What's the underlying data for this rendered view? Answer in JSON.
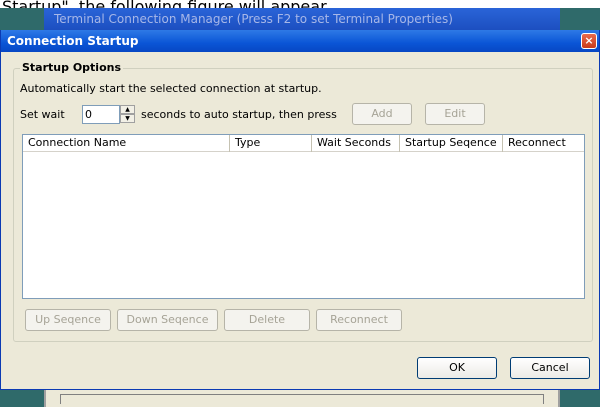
{
  "doc_caption": "Startup\", the following figure will appear.",
  "background_window": {
    "title": "Terminal Connection Manager (Press F2 to set Terminal Properties)"
  },
  "dialog": {
    "title": "Connection Startup",
    "close_label": "×",
    "group_title": "Startup Options",
    "description": "Automatically start the selected connection at startup.",
    "wait_label": "Set wait",
    "wait_value": "0",
    "wait_suffix": "seconds to auto startup, then press",
    "add_label": "Add",
    "edit_label": "Edit",
    "columns": [
      "Connection Name",
      "Type",
      "Wait Seconds",
      "Startup Seqence",
      "Reconnect"
    ],
    "rows": [],
    "up_label": "Up Seqence",
    "down_label": "Down Seqence",
    "delete_label": "Delete",
    "reconnect_label": "Reconnect",
    "ok_label": "OK",
    "cancel_label": "Cancel"
  },
  "colors": {
    "titlebar": "#0a55d6",
    "dialog_bg": "#ece9d8",
    "desktop": "#2f6a6a"
  }
}
